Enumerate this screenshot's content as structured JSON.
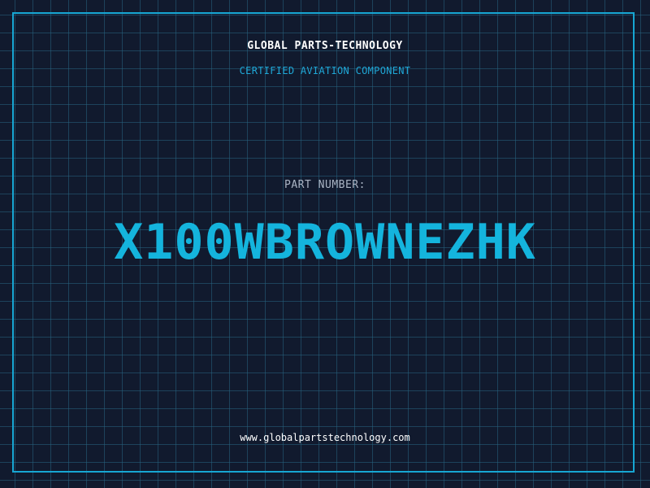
{
  "header": {
    "company": "GLOBAL PARTS-TECHNOLOGY",
    "subtitle": "CERTIFIED AVIATION COMPONENT"
  },
  "part": {
    "label": "PART NUMBER:",
    "number": "X100WBROWNEZHK"
  },
  "footer": {
    "website": "www.globalpartstechnology.com"
  },
  "colors": {
    "background": "#111a2e",
    "grid": "#266280",
    "accent": "#14b4dd",
    "text": "#ffffff",
    "muted": "#aab4c4"
  }
}
